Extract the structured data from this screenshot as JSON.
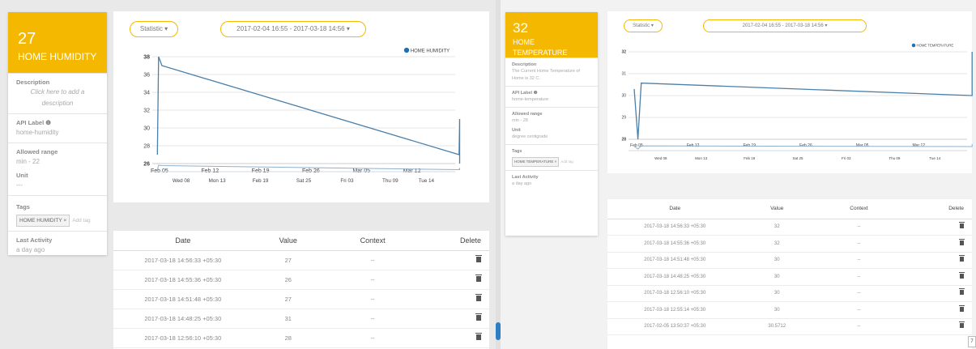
{
  "left": {
    "card": {
      "value": "27",
      "name": "HOME HUMIDITY",
      "description_label": "Description",
      "description_text": "Click here to add a description",
      "api_label_label": "API Label ❶",
      "api_label_value": "home-humidity",
      "allowed_range_label": "Allowed range",
      "allowed_range_value": "min - 22",
      "unit_label": "Unit",
      "unit_value": "---",
      "tags_label": "Tags",
      "tag": "HOME HUMIDITY",
      "tag_remove": "×",
      "add_tag": "Add tag",
      "last_activity_label": "Last Activity",
      "last_activity_value": "a day ago"
    },
    "statistic_label": "Statistic ▾",
    "range_label": "2017-02-04 16:55 - 2017-03-18 14:56 ▾",
    "table": {
      "headers": [
        "Date",
        "Value",
        "Context",
        "Delete"
      ],
      "rows": [
        [
          "2017-03-18 14:56:33 +05:30",
          "27",
          "--"
        ],
        [
          "2017-03-18 14:55:36 +05:30",
          "26",
          "--"
        ],
        [
          "2017-03-18 14:51:48 +05:30",
          "27",
          "--"
        ],
        [
          "2017-03-18 14:48:25 +05:30",
          "31",
          "--"
        ],
        [
          "2017-03-18 12:56:10 +05:30",
          "28",
          "--"
        ]
      ]
    }
  },
  "right": {
    "card": {
      "value": "32",
      "name": "HOME TEMPERATURE",
      "description_label": "Description",
      "description_text": "The Current Home Temperature of Home is 32 C.",
      "api_label_label": "API Label ❶",
      "api_label_value": "home-temperature",
      "allowed_range_label": "Allowed range",
      "allowed_range_value": "min - 28",
      "unit_label": "Unit",
      "unit_value": "degree centigrade",
      "tags_label": "Tags",
      "tag": "HOME TEMPERATURE",
      "tag_remove": "×",
      "add_tag": "Add tag",
      "last_activity_label": "Last Activity",
      "last_activity_value": "a day ago"
    },
    "statistic_label": "Statistic ▾",
    "range_label": "2017-02-04 16:55 - 2017-03-18 14:56 ▾",
    "table": {
      "headers": [
        "Date",
        "Value",
        "Context",
        "Delete"
      ],
      "rows": [
        [
          "2017-03-18 14:56:33 +05:30",
          "32",
          "--"
        ],
        [
          "2017-03-18 14:55:36 +05:30",
          "32",
          "--"
        ],
        [
          "2017-03-18 14:51:48 +05:30",
          "30",
          "--"
        ],
        [
          "2017-03-18 14:48:25 +05:30",
          "30",
          "--"
        ],
        [
          "2017-03-18 12:56:10 +05:30",
          "30",
          "--"
        ],
        [
          "2017-03-18 12:55:14 +05:30",
          "30",
          "--"
        ],
        [
          "2017-02-05 13:50:37 +05:30",
          "30.5712",
          "--"
        ]
      ]
    }
  },
  "corner_label": "7",
  "colors": {
    "accent": "#f5b800",
    "line": "#4a7fa8",
    "legend": "#1f6fb5"
  },
  "chart_data": [
    {
      "type": "line",
      "legend": "HOME HUMIDITY",
      "legend_position": "top-right",
      "ylim": [
        26,
        38
      ],
      "yticks": [
        "26",
        "28",
        "30",
        "32",
        "34",
        "36",
        "38"
      ],
      "xlim": [
        "2017-02-04",
        "2017-03-18"
      ],
      "xticks": [
        [
          "2017-02-05",
          "Feb 05"
        ],
        [
          "2017-02-12",
          "Feb 12"
        ],
        [
          "2017-02-19",
          "Feb 19"
        ],
        [
          "2017-02-26",
          "Feb 26"
        ],
        [
          "2017-03-05",
          "Mar 05"
        ],
        [
          "2017-03-12",
          "Mar 12"
        ]
      ],
      "navigator_ticks": [
        [
          "2017-02-08",
          "Wed 08"
        ],
        [
          "2017-02-13",
          "Mon 13"
        ],
        [
          "2017-02-19",
          "Feb 19"
        ],
        [
          "2017-02-25",
          "Sat 25"
        ],
        [
          "2017-03-03",
          "Fri 03"
        ],
        [
          "2017-03-09",
          "Thu 09"
        ],
        [
          "2017-03-14",
          "Tue 14"
        ]
      ],
      "grid": true,
      "points": [
        [
          "2017-02-04 16:55",
          27
        ],
        [
          "2017-02-04 21:00",
          38
        ],
        [
          "2017-02-05 08:00",
          37
        ],
        [
          "2017-03-18 12:56",
          27
        ],
        [
          "2017-03-18 14:48",
          31
        ],
        [
          "2017-03-18 14:51",
          27
        ],
        [
          "2017-03-18 14:55",
          26
        ],
        [
          "2017-03-18 14:56",
          27
        ]
      ]
    },
    {
      "type": "line",
      "legend": "HOME TEMPERATURE",
      "legend_position": "top-right",
      "ylim": [
        28,
        32
      ],
      "yticks": [
        "28",
        "29",
        "30",
        "31",
        "32"
      ],
      "xlim": [
        "2017-02-04",
        "2017-03-18"
      ],
      "xticks": [
        [
          "2017-02-05",
          "Feb 05"
        ],
        [
          "2017-02-12",
          "Feb 12"
        ],
        [
          "2017-02-19",
          "Feb 19"
        ],
        [
          "2017-02-26",
          "Feb 26"
        ],
        [
          "2017-03-05",
          "Mar 05"
        ],
        [
          "2017-03-12",
          "Mar 12"
        ]
      ],
      "navigator_ticks": [
        [
          "2017-02-08",
          "Wed 08"
        ],
        [
          "2017-02-13",
          "Mon 13"
        ],
        [
          "2017-02-19",
          "Feb 19"
        ],
        [
          "2017-02-25",
          "Sat 25"
        ],
        [
          "2017-03-03",
          "Fri 03"
        ],
        [
          "2017-03-09",
          "Thu 09"
        ],
        [
          "2017-03-14",
          "Tue 14"
        ]
      ],
      "grid": true,
      "points": [
        [
          "2017-02-04 16:55",
          30.3
        ],
        [
          "2017-02-05 04:00",
          28
        ],
        [
          "2017-02-05 13:50",
          30.5712
        ],
        [
          "2017-03-18 12:56",
          30
        ],
        [
          "2017-03-18 14:48",
          30
        ],
        [
          "2017-03-18 14:51",
          30
        ],
        [
          "2017-03-18 14:55",
          32
        ],
        [
          "2017-03-18 14:56",
          32
        ]
      ]
    }
  ]
}
